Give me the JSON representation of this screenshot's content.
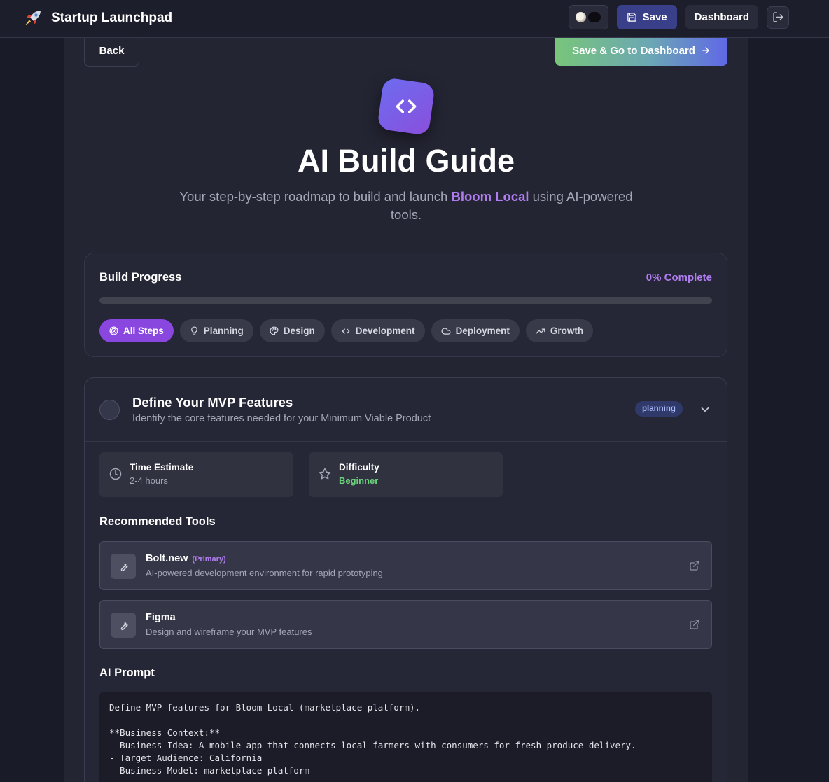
{
  "app": {
    "brand_name": "Startup Launchpad",
    "brand_icon": "rocket-icon"
  },
  "nav": {
    "save_label": "Save",
    "dashboard_label": "Dashboard"
  },
  "page": {
    "back_label": "Back",
    "save_go_label": "Save & Go to Dashboard",
    "title": "AI Build Guide",
    "subtitle_before": "Your step-by-step roadmap to build and launch ",
    "subtitle_accent": "Bloom Local",
    "subtitle_after": " using AI-powered tools."
  },
  "progress": {
    "title": "Build Progress",
    "percent_text": "0% Complete",
    "value": 0,
    "filters": [
      {
        "label": "All Steps",
        "icon": "target-icon",
        "active": true
      },
      {
        "label": "Planning",
        "icon": "lightbulb-icon",
        "active": false
      },
      {
        "label": "Design",
        "icon": "palette-icon",
        "active": false
      },
      {
        "label": "Development",
        "icon": "code-icon",
        "active": false
      },
      {
        "label": "Deployment",
        "icon": "cloud-icon",
        "active": false
      },
      {
        "label": "Growth",
        "icon": "trending-up-icon",
        "active": false
      }
    ]
  },
  "step": {
    "title": "Define Your MVP Features",
    "description": "Identify the core features needed for your Minimum Viable Product",
    "badge": "planning",
    "time_label": "Time Estimate",
    "time_value": "2-4 hours",
    "difficulty_label": "Difficulty",
    "difficulty_value": "Beginner",
    "tools_heading": "Recommended Tools",
    "tools": [
      {
        "name": "Bolt.new",
        "tag": "(Primary)",
        "description": "AI-powered development environment for rapid prototyping"
      },
      {
        "name": "Figma",
        "tag": "",
        "description": "Design and wireframe your MVP features"
      }
    ],
    "prompt_heading": "AI Prompt",
    "prompt_text": "Define MVP features for Bloom Local (marketplace platform).\n\n**Business Context:**\n- Business Idea: A mobile app that connects local farmers with consumers for fresh produce delivery.\n- Target Audience: California\n- Business Model: marketplace platform"
  },
  "colors": {
    "accent_purple": "#8a47e0",
    "accent_text": "#b07df0",
    "nav_save": "#3a3f8a",
    "difficulty_green": "#6bd37b"
  }
}
